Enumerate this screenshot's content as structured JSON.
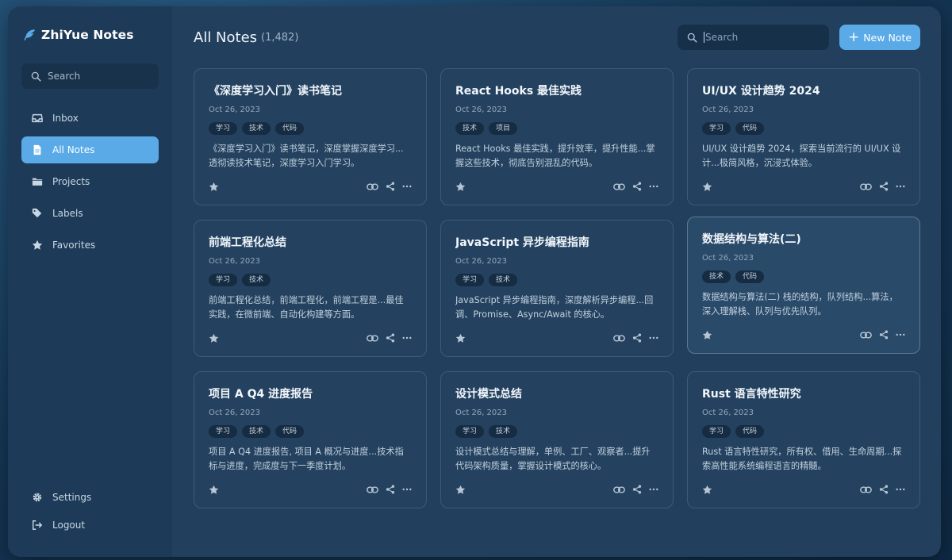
{
  "app": {
    "name": "ZhiYue Notes",
    "accent": "#5aaae8"
  },
  "sidebar": {
    "search_placeholder": "Search",
    "items": [
      {
        "label": "Inbox",
        "icon": "inbox-icon"
      },
      {
        "label": "All Notes",
        "icon": "note-icon",
        "active": true
      },
      {
        "label": "Projects",
        "icon": "folder-icon"
      },
      {
        "label": "Labels",
        "icon": "tag-icon"
      },
      {
        "label": "Favorites",
        "icon": "star-icon"
      }
    ],
    "bottom": [
      {
        "label": "Settings",
        "icon": "gear-icon"
      },
      {
        "label": "Logout",
        "icon": "logout-icon"
      }
    ]
  },
  "header": {
    "title": "All Notes",
    "count": "(1,482)",
    "search_placeholder": "Search",
    "new_note_label": "New Note"
  },
  "notes": [
    {
      "title": "《深度学习入门》读书笔记",
      "date": "Oct 26, 2023",
      "tags": [
        "学习",
        "技术",
        "代码"
      ],
      "desc": "《深度学习入门》读书笔记，深度掌握深度学习...透彻读技术笔记，深度学习入门学习。"
    },
    {
      "title": "React Hooks 最佳实践",
      "date": "Oct 26, 2023",
      "tags": [
        "技术",
        "项目"
      ],
      "desc": "React Hooks 最佳实践，提升效率，提升性能...掌握这些技术，彻底告别混乱的代码。"
    },
    {
      "title": "UI/UX 设计趋势 2024",
      "date": "Oct 26, 2023",
      "tags": [
        "学习",
        "代码"
      ],
      "desc": "UI/UX 设计趋势 2024，探索当前流行的 UI/UX 设计...极简风格，沉浸式体验。"
    },
    {
      "title": "前端工程化总结",
      "date": "Oct 26, 2023",
      "tags": [
        "学习",
        "技术"
      ],
      "desc": "前端工程化总结，前端工程化，前端工程是...最佳实践，在微前端、自动化构建等方面。"
    },
    {
      "title": "JavaScript 异步编程指南",
      "date": "Oct 26, 2023",
      "tags": [
        "学习",
        "技术"
      ],
      "desc": "JavaScript 异步编程指南，深度解析异步编程...回调、Promise、Async/Await 的核心。"
    },
    {
      "title": "数据结构与算法(二)",
      "date": "Oct 26, 2023",
      "tags": [
        "技术",
        "代码"
      ],
      "desc": "数据结构与算法(二) 栈的结构，队列结构...算法，深入理解栈、队列与优先队列。",
      "highlighted": true
    },
    {
      "title": "项目 A Q4 进度报告",
      "date": "Oct 26, 2023",
      "tags": [
        "学习",
        "技术",
        "代码"
      ],
      "desc": "项目 A Q4 进度报告, 项目 A 概况与进度...技术指标与进度，完成度与下一季度计划。"
    },
    {
      "title": "设计模式总结",
      "date": "Oct 26, 2023",
      "tags": [
        "学习",
        "技术"
      ],
      "desc": "设计模式总结与理解，单例、工厂、观察者...提升代码架构质量，掌握设计模式的核心。"
    },
    {
      "title": "Rust 语言特性研究",
      "date": "Oct 26, 2023",
      "tags": [
        "学习",
        "代码"
      ],
      "desc": "Rust 语言特性研究，所有权、借用、生命周期...探索高性能系统编程语言的精髓。"
    }
  ]
}
